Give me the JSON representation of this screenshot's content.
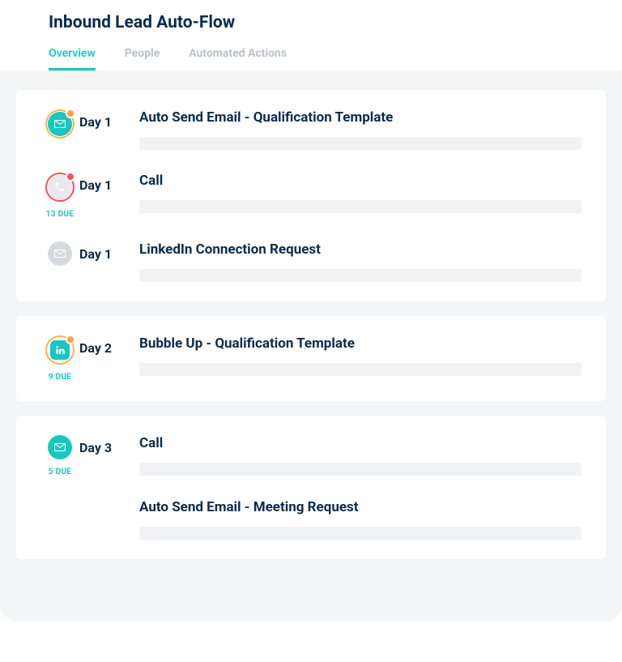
{
  "title": "Inbound Lead Auto-Flow",
  "tabs": [
    {
      "label": "Overview",
      "active": true
    },
    {
      "label": "People",
      "active": false
    },
    {
      "label": "Automated Actions",
      "active": false
    }
  ],
  "groups": [
    {
      "steps": [
        {
          "icon": "email-ring",
          "due": "",
          "day": "Day 1",
          "title": "Auto Send Email - Qualification Template"
        },
        {
          "icon": "call-ring",
          "due": "13 DUE",
          "day": "Day 1",
          "title": "Call"
        },
        {
          "icon": "email-gray",
          "due": "",
          "day": "Day 1",
          "title": "LinkedIn Connection Request"
        }
      ]
    },
    {
      "steps": [
        {
          "icon": "linkedin-ring",
          "due": "9 DUE",
          "day": "Day 2",
          "title": "Bubble Up - Qualification Template"
        }
      ]
    },
    {
      "steps": [
        {
          "icon": "email-teal",
          "due": "5 DUE",
          "day": "Day 3",
          "title": "Call"
        },
        {
          "icon": "",
          "due": "",
          "day": "",
          "title": "Auto Send Email - Meeting Request"
        }
      ]
    }
  ]
}
